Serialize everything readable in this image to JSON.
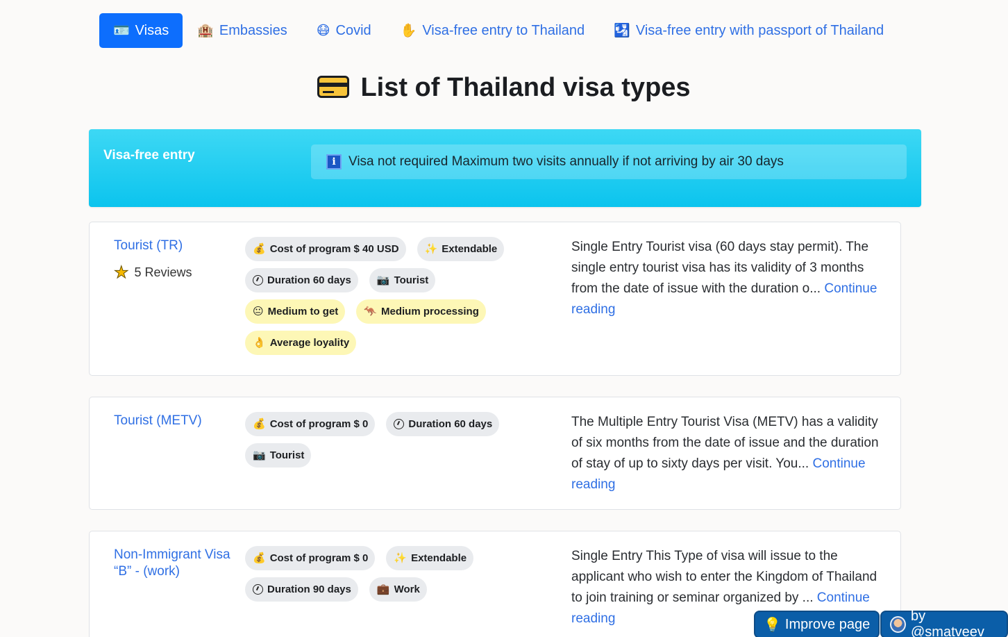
{
  "nav": {
    "items": [
      {
        "label": "Visas",
        "icon": "passport-icon",
        "glyph": "🪪",
        "active": true
      },
      {
        "label": "Embassies",
        "icon": "building-icon",
        "glyph": "🏨"
      },
      {
        "label": "Covid",
        "icon": "mask-face-icon",
        "glyph": "😷"
      },
      {
        "label": "Visa-free entry to Thailand",
        "icon": "raised-hand-icon",
        "glyph": "✋"
      },
      {
        "label": "Visa-free entry with passport of Thailand",
        "icon": "passport-control-icon",
        "glyph": "🛂"
      }
    ]
  },
  "title": "List of Thailand visa types",
  "banner": {
    "title": "Visa-free entry",
    "info_glyph": "i",
    "note": "Visa not required Maximum two visits annually if not arriving by air 30 days"
  },
  "visas": [
    {
      "name": "Tourist (TR)",
      "reviews": "5 Reviews",
      "star": "★",
      "badges": {
        "cost": "Cost of program $ 40 USD",
        "extendable": "Extendable",
        "duration": "Duration 60 days",
        "type": "Tourist",
        "difficulty": "Medium to get",
        "processing": "Medium processing",
        "loyalty": "Average loyality"
      },
      "description": "Single Entry Tourist visa (60 days stay permit). The single entry tourist visa has its validity of 3 months from the date of issue with the duration o...",
      "more": "Continue reading"
    },
    {
      "name": "Tourist (METV)",
      "badges": {
        "cost": "Cost of program $ 0",
        "duration": "Duration 60 days",
        "type": "Tourist"
      },
      "description": "The Multiple Entry Tourist Visa (METV) has a validity of six months from the date of issue and the duration of stay of up to sixty days per visit. You...",
      "more": "Continue reading"
    },
    {
      "name": "Non-Immigrant Visa “B” - (work)",
      "badges": {
        "cost": "Cost of program $ 0",
        "extendable": "Extendable",
        "duration": "Duration 90 days",
        "type": "Work"
      },
      "description": "Single Entry This Type of visa will issue to the applicant who wish to enter the Kingdom of Thailand to join training or seminar organized by ...",
      "more": "Continue reading"
    }
  ],
  "buttons": {
    "improve": "Improve page",
    "author": "by @smatveev"
  },
  "colors": {
    "primary": "#0d6efd",
    "link": "#2f6fe4",
    "banner": "#0cc4ee",
    "badge_grey": "#e9ebee",
    "badge_yellow": "#fdf7b6",
    "float_button": "#0b5ea8"
  }
}
